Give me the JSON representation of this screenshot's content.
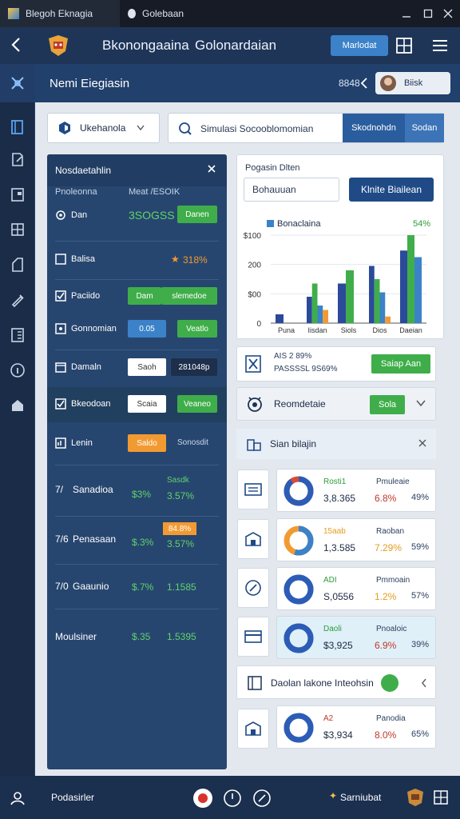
{
  "titlebar": {
    "tab1": "Blegoh Eknagia",
    "tab2": "Golebaan"
  },
  "header": {
    "title_a": "Bkonongaaina",
    "title_b": "Golonardaian",
    "button": "Marlodat"
  },
  "subheader": {
    "title": "Nemi Eiegiasin",
    "code": "8848",
    "user_name": "Biisk"
  },
  "selector": {
    "value": "Ukehanola"
  },
  "search": {
    "text": "Simulasi Socooblomomian",
    "btn1": "Skodnohdn",
    "btn2": "Sodan"
  },
  "left_panel": {
    "title": "Nosdaetahlin",
    "col_a": "Pnoleonna",
    "col_b": "Meat /ESOIK",
    "rows": [
      {
        "label": "Dan",
        "value": "3SOGSS",
        "btn": "Danen"
      },
      {
        "label": "Balisa",
        "value": "318%"
      },
      {
        "label": "Paciido",
        "btn1": "Dam",
        "btn2": "slemedoe"
      },
      {
        "label": "Gonnomian",
        "btn1": "0.05",
        "btn2": "Veatlo"
      },
      {
        "label": "Damaln",
        "box1": "Saoh",
        "box2": "281048p"
      },
      {
        "label": "Bkeodoan",
        "box1": "Scaia",
        "btn2": "Veaneo"
      },
      {
        "label": "Lenin",
        "btn1": "Saldo",
        "text2": "Sonosdit"
      }
    ],
    "stats": [
      {
        "prefix": "7/",
        "label": "Sanadioa",
        "v1": "$3%",
        "top": "Sasdk",
        "v2": "3.57%"
      },
      {
        "prefix": "7/6",
        "label": "Penasaan",
        "v1": "$.3%",
        "top": "84.8%",
        "v2": "3.57%"
      },
      {
        "prefix": "7/0",
        "label": "Gaaunio",
        "v1": "$.7%",
        "v2": "1.1585"
      },
      {
        "prefix": "",
        "label": "Moulsiner",
        "v1": "$.35",
        "v2": "1.5395"
      }
    ]
  },
  "right_panel": {
    "label": "Pogasin Dlten",
    "input_value": "Bohauuan",
    "button": "Klnite Biailean"
  },
  "chart_data": {
    "type": "bar",
    "title": "Bonaclaina",
    "corner_value": "54%",
    "categories": [
      "Puna",
      "Iisdan",
      "Siols",
      "Dios",
      "Daeian"
    ],
    "y_ticks": [
      "0",
      "$00",
      "200",
      "$100"
    ],
    "ylim": [
      0,
      400
    ],
    "series": [
      {
        "color": "#2c4a9a",
        "values": [
          40,
          120,
          180,
          260,
          330
        ]
      },
      {
        "color": "#3fae4a",
        "values": [
          0,
          180,
          240,
          200,
          400
        ]
      },
      {
        "color": "#3b82c9",
        "values": [
          0,
          80,
          0,
          140,
          300
        ]
      },
      {
        "color": "#f29a32",
        "values": [
          0,
          60,
          0,
          30,
          0
        ]
      }
    ]
  },
  "stat_card": {
    "line1": "AIS 2 89%",
    "line2": "PASSSSL 9S69%",
    "button": "Saiap Aan"
  },
  "card2": {
    "label": "Reomdetaie",
    "button": "Sola"
  },
  "section": {
    "title": "Sian bilajin"
  },
  "metric_cards": [
    {
      "l1": "Rosti1",
      "l2": "3,8.365",
      "r1": "Pmuleaie",
      "r2": "6.8%",
      "r3": "49%",
      "l1_color": "#2e9c3b",
      "r2_color": "#c0392b",
      "ring": "#2c5cb6",
      "ring_accent": "#d84a3a",
      "pct": 0.9
    },
    {
      "l1": "15aab",
      "l2": "1,3.585",
      "r1": "Raoban",
      "r2": "7.29%",
      "r3": "59%",
      "l1_color": "#e69b1e",
      "r2_color": "#e69b1e",
      "ring": "#3b82c9",
      "ring_accent": "#f29a32",
      "pct": 0.55
    },
    {
      "l1": "ADI",
      "l2": "S,0556",
      "r1": "Pmmoain",
      "r2": "1.2%",
      "r3": "57%",
      "l1_color": "#2e9c3b",
      "r2_color": "#e69b1e",
      "ring": "#2c5cb6",
      "ring_accent": "#2c5cb6",
      "pct": 1.0
    },
    {
      "l1": "Daoli",
      "l2": "$3,925",
      "r1": "Pnoaloic",
      "r2": "6.9%",
      "r3": "39%",
      "l1_color": "#2e9c3b",
      "r2_color": "#c0392b",
      "ring": "#2c5cb6",
      "ring_accent": "#2c5cb6",
      "pct": 1.0
    },
    {
      "l1": "A2",
      "l2": "$3,934",
      "r1": "Panodia",
      "r2": "8.0%",
      "r3": "65%",
      "l1_color": "#c0392b",
      "r2_color": "#c0392b",
      "ring": "#2c5cb6",
      "ring_accent": "#2c5cb6",
      "pct": 0.95
    }
  ],
  "toggle_row": {
    "label": "Daolan lakone Inteohsin"
  },
  "bottombar": {
    "left": "Podasirler",
    "right": "Sarniubat"
  }
}
